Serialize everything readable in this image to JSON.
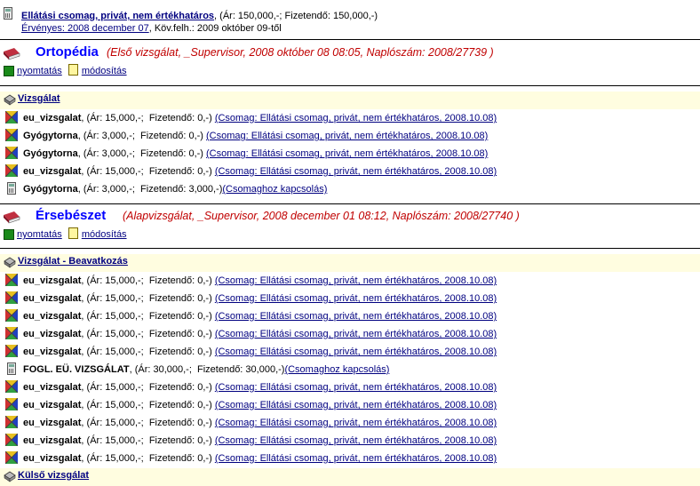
{
  "package": {
    "title": "Ellátási csomag, privát, nem értékhatáros",
    "price_text": ", (Ár: 150,000,-; Fizetendő: 150,000,-)",
    "valid_link": "Érvényes: 2008 december 07",
    "next_use": ", Köv.felh.: 2009 október 09-től"
  },
  "sections": [
    {
      "name": "Ortopédia",
      "info": "(Első vizsgálat, _Supervisor, 2008 október 08  08:05, Naplószám: 2008/27739 )",
      "print_label": "nyomtatás",
      "edit_label": "módosítás",
      "group_label": "Vizsgálat",
      "rows": [
        {
          "name": "eu_vizsgalat",
          "price": ", (Ár: 15,000,-;  Fizetendő: 0,-) ",
          "link": "(Csomag: Ellátási csomag, privát, nem értékhatáros, 2008.10.08)",
          "icon": "cross-icon"
        },
        {
          "name": "Gyógytorna",
          "price": ", (Ár: 3,000,-;  Fizetendő: 0,-) ",
          "link": "(Csomag: Ellátási csomag, privát, nem értékhatáros, 2008.10.08)",
          "icon": "cross-icon"
        },
        {
          "name": "Gyógytorna",
          "price": ", (Ár: 3,000,-;  Fizetendő: 0,-) ",
          "link": "(Csomag: Ellátási csomag, privát, nem értékhatáros, 2008.10.08)",
          "icon": "cross-icon"
        },
        {
          "name": "eu_vizsgalat",
          "price": ", (Ár: 15,000,-;  Fizetendő: 0,-) ",
          "link": "(Csomag: Ellátási csomag, privát, nem értékhatáros, 2008.10.08)",
          "icon": "cross-icon"
        },
        {
          "name": "Gyógytorna",
          "price": ", (Ár: 3,000,-;  Fizetendő: 3,000,-)",
          "link": "(Csomaghoz kapcsolás)",
          "icon": "calculator-icon"
        }
      ]
    },
    {
      "name": "Érsebészet",
      "info": "(Alapvizsgálat, _Supervisor, 2008 december 01  08:12, Naplószám: 2008/27740 )",
      "print_label": "nyomtatás",
      "edit_label": "módosítás",
      "group_label": "Vizsgálat - Beavatkozás",
      "rows": [
        {
          "name": "eu_vizsgalat",
          "price": ", (Ár: 15,000,-;  Fizetendő: 0,-) ",
          "link": "(Csomag: Ellátási csomag, privát, nem értékhatáros, 2008.10.08)",
          "icon": "cross-icon"
        },
        {
          "name": "eu_vizsgalat",
          "price": ", (Ár: 15,000,-;  Fizetendő: 0,-) ",
          "link": "(Csomag: Ellátási csomag, privát, nem értékhatáros, 2008.10.08)",
          "icon": "cross-icon"
        },
        {
          "name": "eu_vizsgalat",
          "price": ", (Ár: 15,000,-;  Fizetendő: 0,-) ",
          "link": "(Csomag: Ellátási csomag, privát, nem értékhatáros, 2008.10.08)",
          "icon": "cross-icon"
        },
        {
          "name": "eu_vizsgalat",
          "price": ", (Ár: 15,000,-;  Fizetendő: 0,-) ",
          "link": "(Csomag: Ellátási csomag, privát, nem értékhatáros, 2008.10.08)",
          "icon": "cross-icon"
        },
        {
          "name": "eu_vizsgalat",
          "price": ", (Ár: 15,000,-;  Fizetendő: 0,-) ",
          "link": "(Csomag: Ellátási csomag, privát, nem értékhatáros, 2008.10.08)",
          "icon": "cross-icon"
        },
        {
          "name": "FOGL. EÜ. VIZSGÁLAT",
          "price": ", (Ár: 30,000,-;  Fizetendő: 30,000,-)",
          "link": "(Csomaghoz kapcsolás)",
          "icon": "calculator-icon"
        },
        {
          "name": "eu_vizsgalat",
          "price": ", (Ár: 15,000,-;  Fizetendő: 0,-) ",
          "link": "(Csomag: Ellátási csomag, privát, nem értékhatáros, 2008.10.08)",
          "icon": "cross-icon"
        },
        {
          "name": "eu_vizsgalat",
          "price": ", (Ár: 15,000,-;  Fizetendő: 0,-) ",
          "link": "(Csomag: Ellátási csomag, privát, nem értékhatáros, 2008.10.08)",
          "icon": "cross-icon"
        },
        {
          "name": "eu_vizsgalat",
          "price": ", (Ár: 15,000,-;  Fizetendő: 0,-) ",
          "link": "(Csomag: Ellátási csomag, privát, nem értékhatáros, 2008.10.08)",
          "icon": "cross-icon"
        },
        {
          "name": "eu_vizsgalat",
          "price": ", (Ár: 15,000,-;  Fizetendő: 0,-) ",
          "link": "(Csomag: Ellátási csomag, privát, nem értékhatáros, 2008.10.08)",
          "icon": "cross-icon"
        },
        {
          "name": "eu_vizsgalat",
          "price": ", (Ár: 15,000,-;  Fizetendő: 0,-) ",
          "link": "(Csomag: Ellátási csomag, privát, nem értékhatáros, 2008.10.08)",
          "icon": "cross-icon"
        }
      ]
    }
  ],
  "footer_group": {
    "label": "Külső vizsgálat"
  },
  "colors": {
    "link": "#000080",
    "section_title": "#0000ff",
    "section_info": "#c00000",
    "band": "#fffde0"
  }
}
